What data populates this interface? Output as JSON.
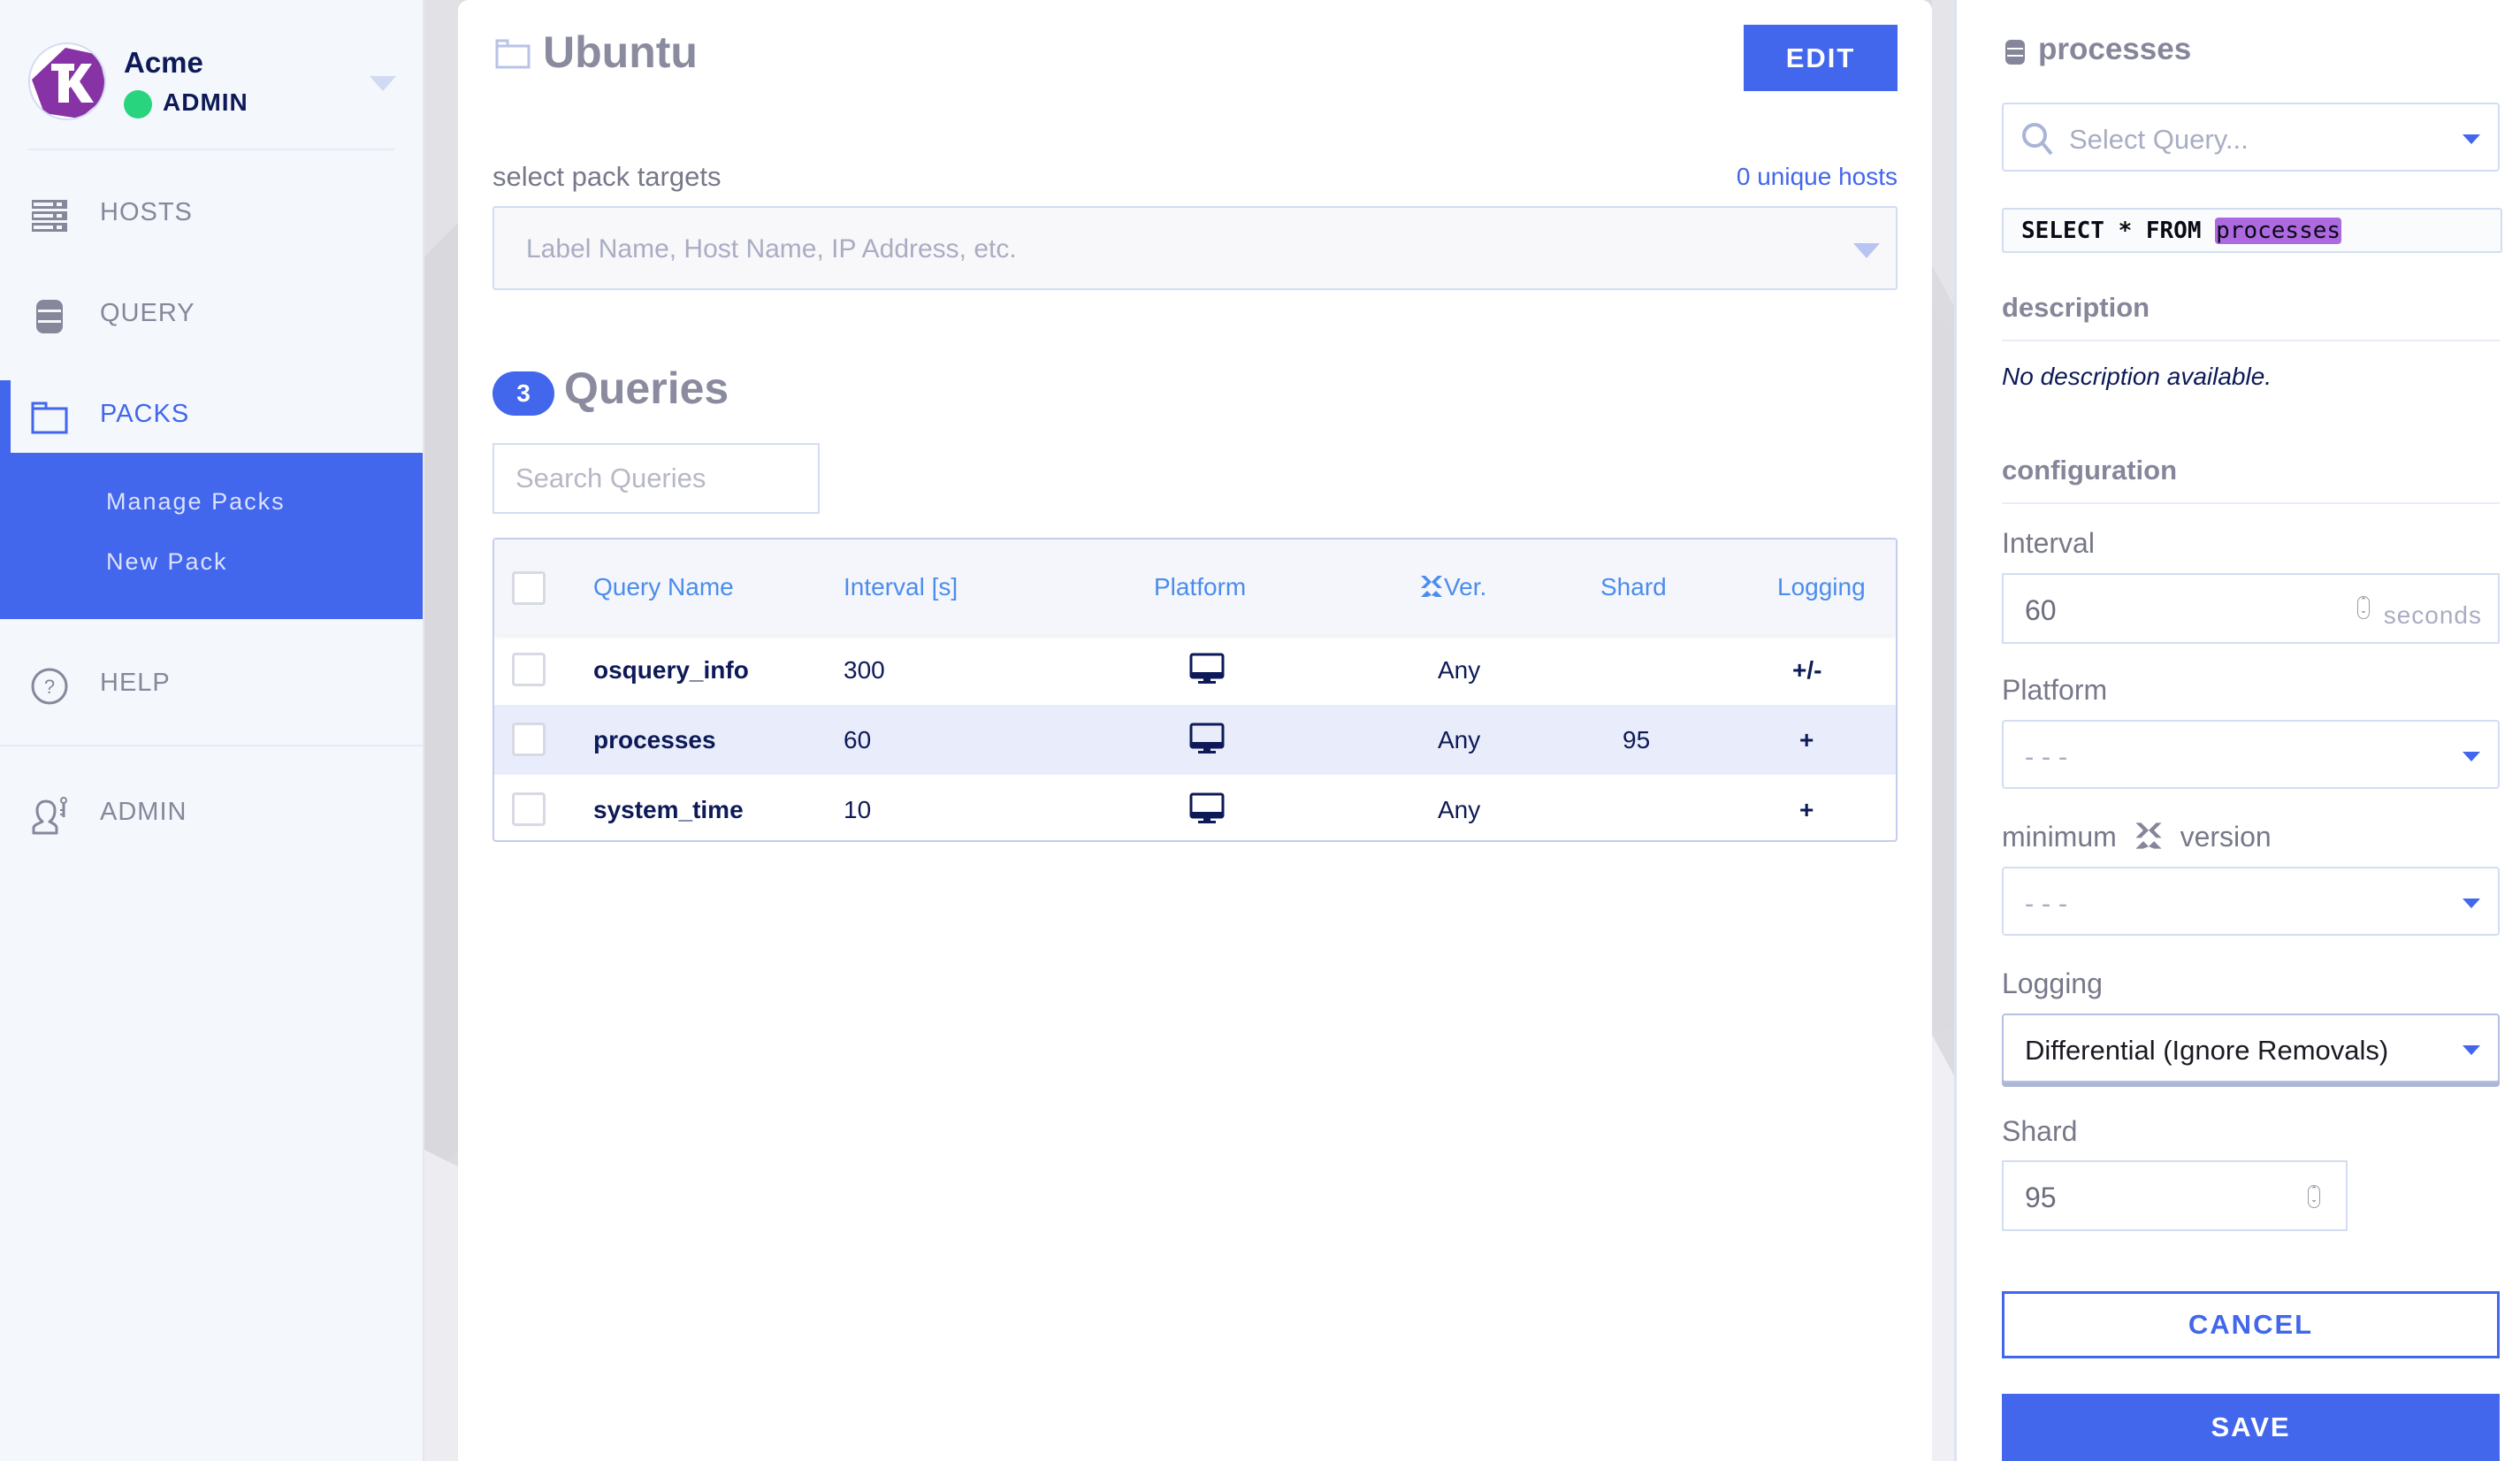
{
  "org": {
    "name": "Acme",
    "role": "ADMIN",
    "status_color": "#28d47e",
    "logo_icon": "kolide-logo-icon"
  },
  "sidebar": {
    "items": [
      {
        "label": "HOSTS",
        "icon": "server-stack-icon",
        "active": false
      },
      {
        "label": "QUERY",
        "icon": "database-icon",
        "active": false
      },
      {
        "label": "PACKS",
        "icon": "folder-icon",
        "active": true
      },
      {
        "label": "HELP",
        "icon": "question-circle-icon",
        "active": false
      },
      {
        "label": "ADMIN",
        "icon": "admin-user-key-icon",
        "active": false
      }
    ],
    "packs_submenu": [
      "Manage Packs",
      "New Pack"
    ]
  },
  "pack": {
    "title": "Ubuntu",
    "edit_label": "EDIT",
    "targets_label": "select pack targets",
    "unique_hosts": "0 unique hosts",
    "targets_placeholder": "Label Name, Host Name, IP Address, etc."
  },
  "queries": {
    "count": "3",
    "title": "Queries",
    "search_placeholder": "Search Queries",
    "columns": [
      "Query Name",
      "Interval [s]",
      "Platform",
      "Ver.",
      "Shard",
      "Logging"
    ],
    "rows": [
      {
        "name": "osquery_info",
        "interval": "300",
        "platform": "desktop-icon",
        "version": "Any",
        "shard": "",
        "logging": "+/-",
        "selected": false
      },
      {
        "name": "processes",
        "interval": "60",
        "platform": "desktop-icon",
        "version": "Any",
        "shard": "95",
        "logging": "+",
        "selected": true
      },
      {
        "name": "system_time",
        "interval": "10",
        "platform": "desktop-icon",
        "version": "Any",
        "shard": "",
        "logging": "+",
        "selected": false
      }
    ]
  },
  "editor": {
    "title": "processes",
    "select_query_placeholder": "Select Query...",
    "sql_prefix": "SELECT * FROM ",
    "sql_table": "processes",
    "description_label": "description",
    "description_text": "No description available.",
    "configuration_label": "configuration",
    "interval_label": "Interval",
    "interval_value": "60",
    "interval_unit": "seconds",
    "platform_label": "Platform",
    "platform_value": "- - -",
    "min_version_label_a": "minimum",
    "min_version_label_b": "version",
    "min_version_value": "- - -",
    "logging_label": "Logging",
    "logging_value": "Differential (Ignore Removals)",
    "shard_label": "Shard",
    "shard_value": "95",
    "cancel_label": "CANCEL",
    "save_label": "SAVE"
  },
  "colors": {
    "accent": "#4266ec",
    "header_link": "#4b8dec",
    "text_dark": "#0d1a57",
    "sql_highlight": "#ad69e0"
  }
}
